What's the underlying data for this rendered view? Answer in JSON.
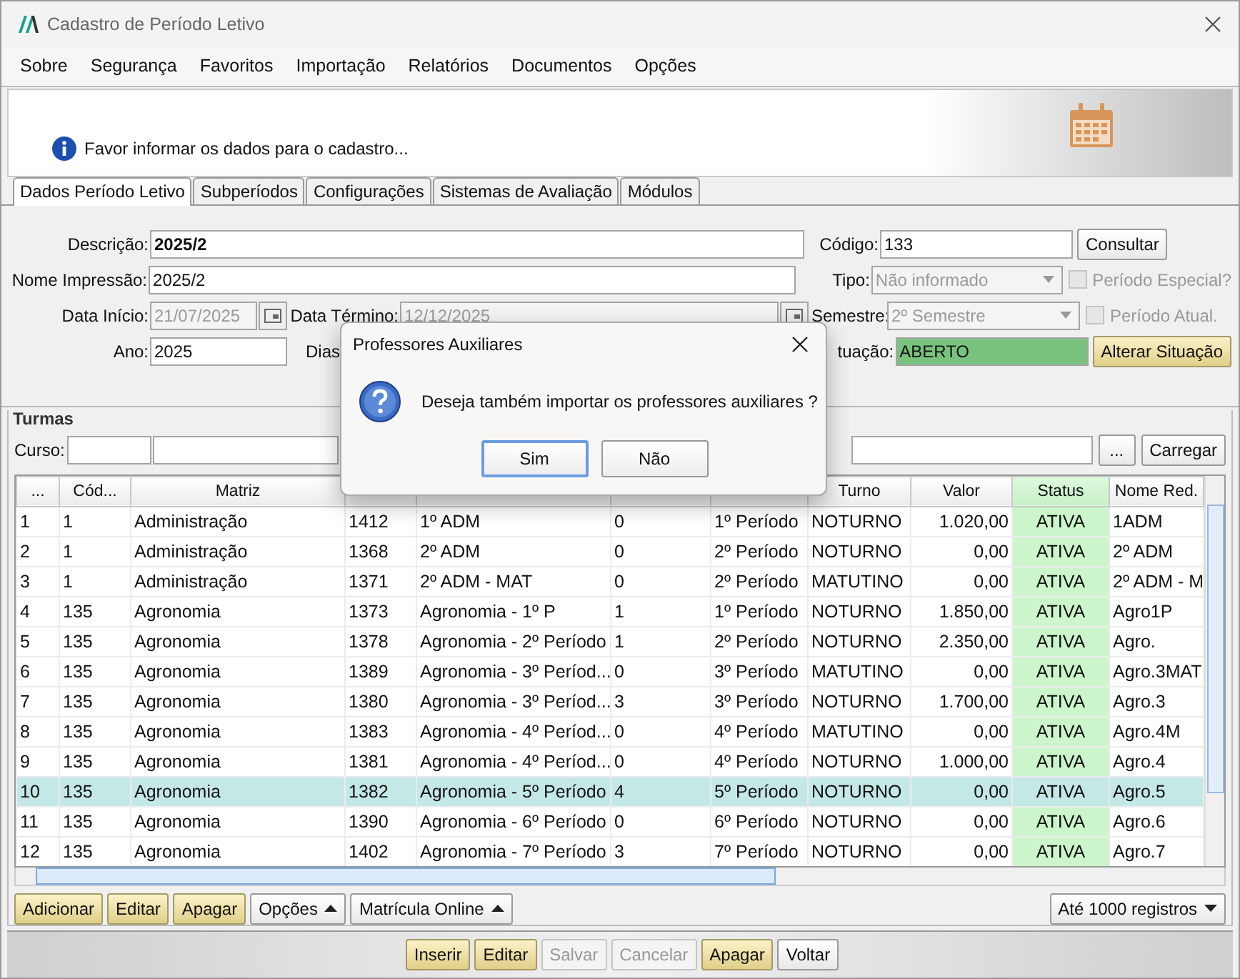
{
  "window": {
    "title": "Cadastro de Período Letivo"
  },
  "menu": [
    {
      "label": "Sobre"
    },
    {
      "label": "Segurança"
    },
    {
      "label": "Favoritos"
    },
    {
      "label": "Importação"
    },
    {
      "label": "Relatórios"
    },
    {
      "label": "Documentos"
    },
    {
      "label": "Opções"
    }
  ],
  "info": {
    "message": "Favor informar os dados para o cadastro..."
  },
  "tabs": [
    {
      "label": "Dados Período Letivo",
      "selected": true
    },
    {
      "label": "Subperíodos",
      "selected": false
    },
    {
      "label": "Configurações",
      "selected": false
    },
    {
      "label": "Sistemas de Avaliação",
      "selected": false
    },
    {
      "label": "Módulos",
      "selected": false
    }
  ],
  "form": {
    "descricao": {
      "label": "Descrição:",
      "value": "2025/2"
    },
    "nome_impressao": {
      "label": "Nome Impressão:",
      "value": "2025/2"
    },
    "data_inicio": {
      "label": "Data Início:",
      "value": "21/07/2025",
      "disabled": true
    },
    "data_termino": {
      "label": "Data Término:",
      "value": "12/12/2025",
      "disabled": true
    },
    "ano": {
      "label": "Ano:",
      "value": "2025"
    },
    "dias": {
      "label": "Dias"
    },
    "codigo": {
      "label": "Código:",
      "value": "133"
    },
    "consultar": {
      "label": "Consultar"
    },
    "tipo": {
      "label": "Tipo:",
      "value": "Não informado",
      "disabled": true
    },
    "semestre": {
      "label": "Semestre:",
      "value": "2º Semestre",
      "disabled": true
    },
    "situacao": {
      "label": "tuação:",
      "value": "ABERTO"
    },
    "alterar": {
      "label": "Alterar Situação"
    },
    "checks": [
      {
        "label": "Período Especial?",
        "checked": false,
        "disabled": true
      },
      {
        "label": "Período Atual.",
        "checked": false,
        "disabled": true
      }
    ]
  },
  "turmas": {
    "title": "Turmas",
    "curso_label": "Curso:",
    "browse": "...",
    "load": "Carregar",
    "table": {
      "columns": [
        {
          "label": "...",
          "kind": "text"
        },
        {
          "label": "Cód...",
          "kind": "text"
        },
        {
          "label": "Matriz",
          "kind": "text"
        },
        {
          "kind": "text"
        },
        {
          "kind": "text"
        },
        {
          "kind": "text"
        },
        {
          "kind": "text"
        },
        {
          "label": "Turno",
          "kind": "text"
        },
        {
          "label": "Valor",
          "kind": "number"
        },
        {
          "label": "Status",
          "kind": "status"
        },
        {
          "label": "Nome Red.",
          "kind": "text"
        }
      ],
      "rows": [
        {
          "selected": false,
          "cells": [
            "1",
            "1",
            "Administração",
            "1412",
            "1º ADM",
            "0",
            "1º Período",
            "NOTURNO",
            "1.020,00",
            "ATIVA",
            "1ADM"
          ]
        },
        {
          "selected": false,
          "cells": [
            "2",
            "1",
            "Administração",
            "1368",
            "2º ADM",
            "0",
            "2º Período",
            "NOTURNO",
            "0,00",
            "ATIVA",
            "2º ADM"
          ]
        },
        {
          "selected": false,
          "cells": [
            "3",
            "1",
            "Administração",
            "1371",
            "2º ADM - MAT",
            "0",
            "2º Período",
            "MATUTINO",
            "0,00",
            "ATIVA",
            "2º ADM - M"
          ]
        },
        {
          "selected": false,
          "cells": [
            "4",
            "135",
            "Agronomia",
            "1373",
            "Agronomia - 1º P",
            "1",
            "1º Período",
            "NOTURNO",
            "1.850,00",
            "ATIVA",
            "Agro1P"
          ]
        },
        {
          "selected": false,
          "cells": [
            "5",
            "135",
            "Agronomia",
            "1378",
            "Agronomia - 2º Período",
            "1",
            "2º Período",
            "NOTURNO",
            "2.350,00",
            "ATIVA",
            "Agro."
          ]
        },
        {
          "selected": false,
          "cells": [
            "6",
            "135",
            "Agronomia",
            "1389",
            "Agronomia - 3º Períod...",
            "0",
            "3º Período",
            "MATUTINO",
            "0,00",
            "ATIVA",
            "Agro.3MAT"
          ]
        },
        {
          "selected": false,
          "cells": [
            "7",
            "135",
            "Agronomia",
            "1380",
            "Agronomia - 3º Períod...",
            "3",
            "3º Período",
            "NOTURNO",
            "1.700,00",
            "ATIVA",
            "Agro.3"
          ]
        },
        {
          "selected": false,
          "cells": [
            "8",
            "135",
            "Agronomia",
            "1383",
            "Agronomia - 4º Períod...",
            "0",
            "4º Período",
            "MATUTINO",
            "0,00",
            "ATIVA",
            "Agro.4M"
          ]
        },
        {
          "selected": false,
          "cells": [
            "9",
            "135",
            "Agronomia",
            "1381",
            "Agronomia - 4º Períod...",
            "0",
            "4º Período",
            "NOTURNO",
            "1.000,00",
            "ATIVA",
            "Agro.4"
          ]
        },
        {
          "selected": true,
          "cells": [
            "10",
            "135",
            "Agronomia",
            "1382",
            "Agronomia - 5º Período",
            "4",
            "5º Período",
            "NOTURNO",
            "0,00",
            "ATIVA",
            "Agro.5"
          ]
        },
        {
          "selected": false,
          "cells": [
            "11",
            "135",
            "Agronomia",
            "1390",
            "Agronomia - 6º Período",
            "0",
            "6º Período",
            "NOTURNO",
            "0,00",
            "ATIVA",
            "Agro.6"
          ]
        },
        {
          "selected": false,
          "cells": [
            "12",
            "135",
            "Agronomia",
            "1402",
            "Agronomia - 7º Período",
            "3",
            "7º Período",
            "NOTURNO",
            "0,00",
            "ATIVA",
            "Agro.7"
          ]
        }
      ]
    },
    "buttons": [
      {
        "label": "Adicionar",
        "kind": "action"
      },
      {
        "label": "Editar",
        "kind": "action"
      },
      {
        "label": "Apagar",
        "kind": "action"
      },
      {
        "label": "Opções",
        "kind": "menu"
      },
      {
        "label": "Matrícula Online",
        "kind": "menu"
      }
    ],
    "limit": "Até 1000 registros"
  },
  "footer_buttons": [
    {
      "label": "Inserir",
      "disabled": false
    },
    {
      "label": "Editar",
      "disabled": false
    },
    {
      "label": "Salvar",
      "disabled": true
    },
    {
      "label": "Cancelar",
      "disabled": true
    },
    {
      "label": "Apagar",
      "disabled": false
    },
    {
      "label": "Voltar",
      "disabled": false,
      "kind": "plain"
    }
  ],
  "dialog": {
    "title": "Professores Auxiliares",
    "message": "Deseja também importar os professores auxiliares ?",
    "buttons": [
      {
        "label": "Sim",
        "selected": true
      },
      {
        "label": "Não",
        "selected": false
      }
    ]
  }
}
